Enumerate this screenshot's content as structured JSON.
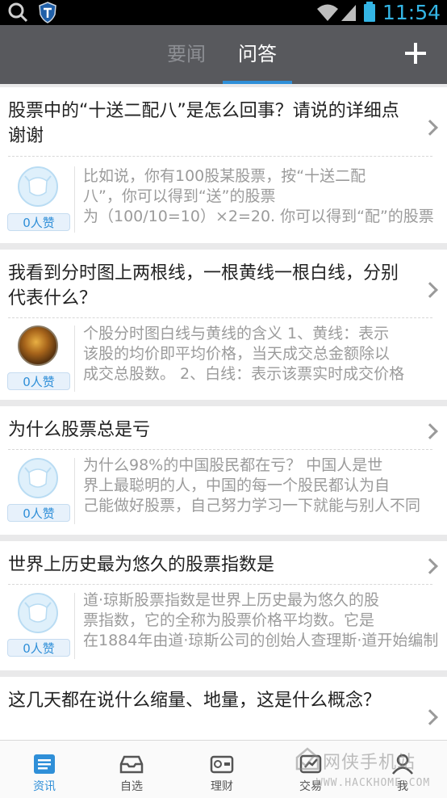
{
  "status_bar": {
    "time": "11:54"
  },
  "header": {
    "tabs": [
      {
        "label": "要闻",
        "active": false
      },
      {
        "label": "问答",
        "active": true
      }
    ]
  },
  "questions": [
    {
      "title": "股票中的“十送二配八”是怎么回事？请说的详细点 谢谢",
      "likes": "0人赞",
      "avatar": "default-avatar",
      "answer_lines": [
        "比如说，你有100股某股票，按“十送二配",
        "八”，你可以得到“送”的股票",
        "为（100/10=10）×2=20. 你可以得到“配”的股票"
      ]
    },
    {
      "title": "我看到分时图上两根线，一根黄线一根白线，分别代表什么？",
      "likes": "0人赞",
      "avatar": "photo-avatar",
      "answer_lines": [
        "个股分时图白线与黄线的含义 1、黄线：表示",
        "该股的均价即平均价格，当天成交总金额除以",
        "成交总股数。 2、白线：表示该票实时成交价格"
      ]
    },
    {
      "title": "为什么股票总是亏",
      "likes": "0人赞",
      "avatar": "default-avatar",
      "answer_lines": [
        "为什么98%的中国股民都在亏？ 中国人是世",
        "界上最聪明的人，中国的每一个股民都认为自",
        "己能做好股票，自己努力学习一下就能与别人不同"
      ]
    },
    {
      "title": "世界上历史最为悠久的股票指数是",
      "likes": "0人赞",
      "avatar": "default-avatar",
      "answer_lines": [
        "道·琼斯股票指数是世界上历史最为悠久的股",
        "票指数，它的全称为股票价格平均数。它是",
        "在1884年由道·琼斯公司的创始人查理斯·道开始编制"
      ]
    },
    {
      "title": "这几天都在说什么缩量、地量，这是什么概念？"
    }
  ],
  "bottom_nav": [
    {
      "label": "资讯",
      "icon": "news-icon",
      "active": true
    },
    {
      "label": "自选",
      "icon": "inbox-icon",
      "active": false
    },
    {
      "label": "理财",
      "icon": "wallet-icon",
      "active": false
    },
    {
      "label": "交易",
      "icon": "trade-icon",
      "active": false
    },
    {
      "label": "我",
      "icon": "person-icon",
      "active": false
    }
  ],
  "watermark": {
    "text": "网侠手机站",
    "url": "WWW.HACKHOME.COM"
  },
  "colors": {
    "accent": "#2f8fd8",
    "header_bg": "#58595d",
    "clock": "#34b5e5"
  }
}
